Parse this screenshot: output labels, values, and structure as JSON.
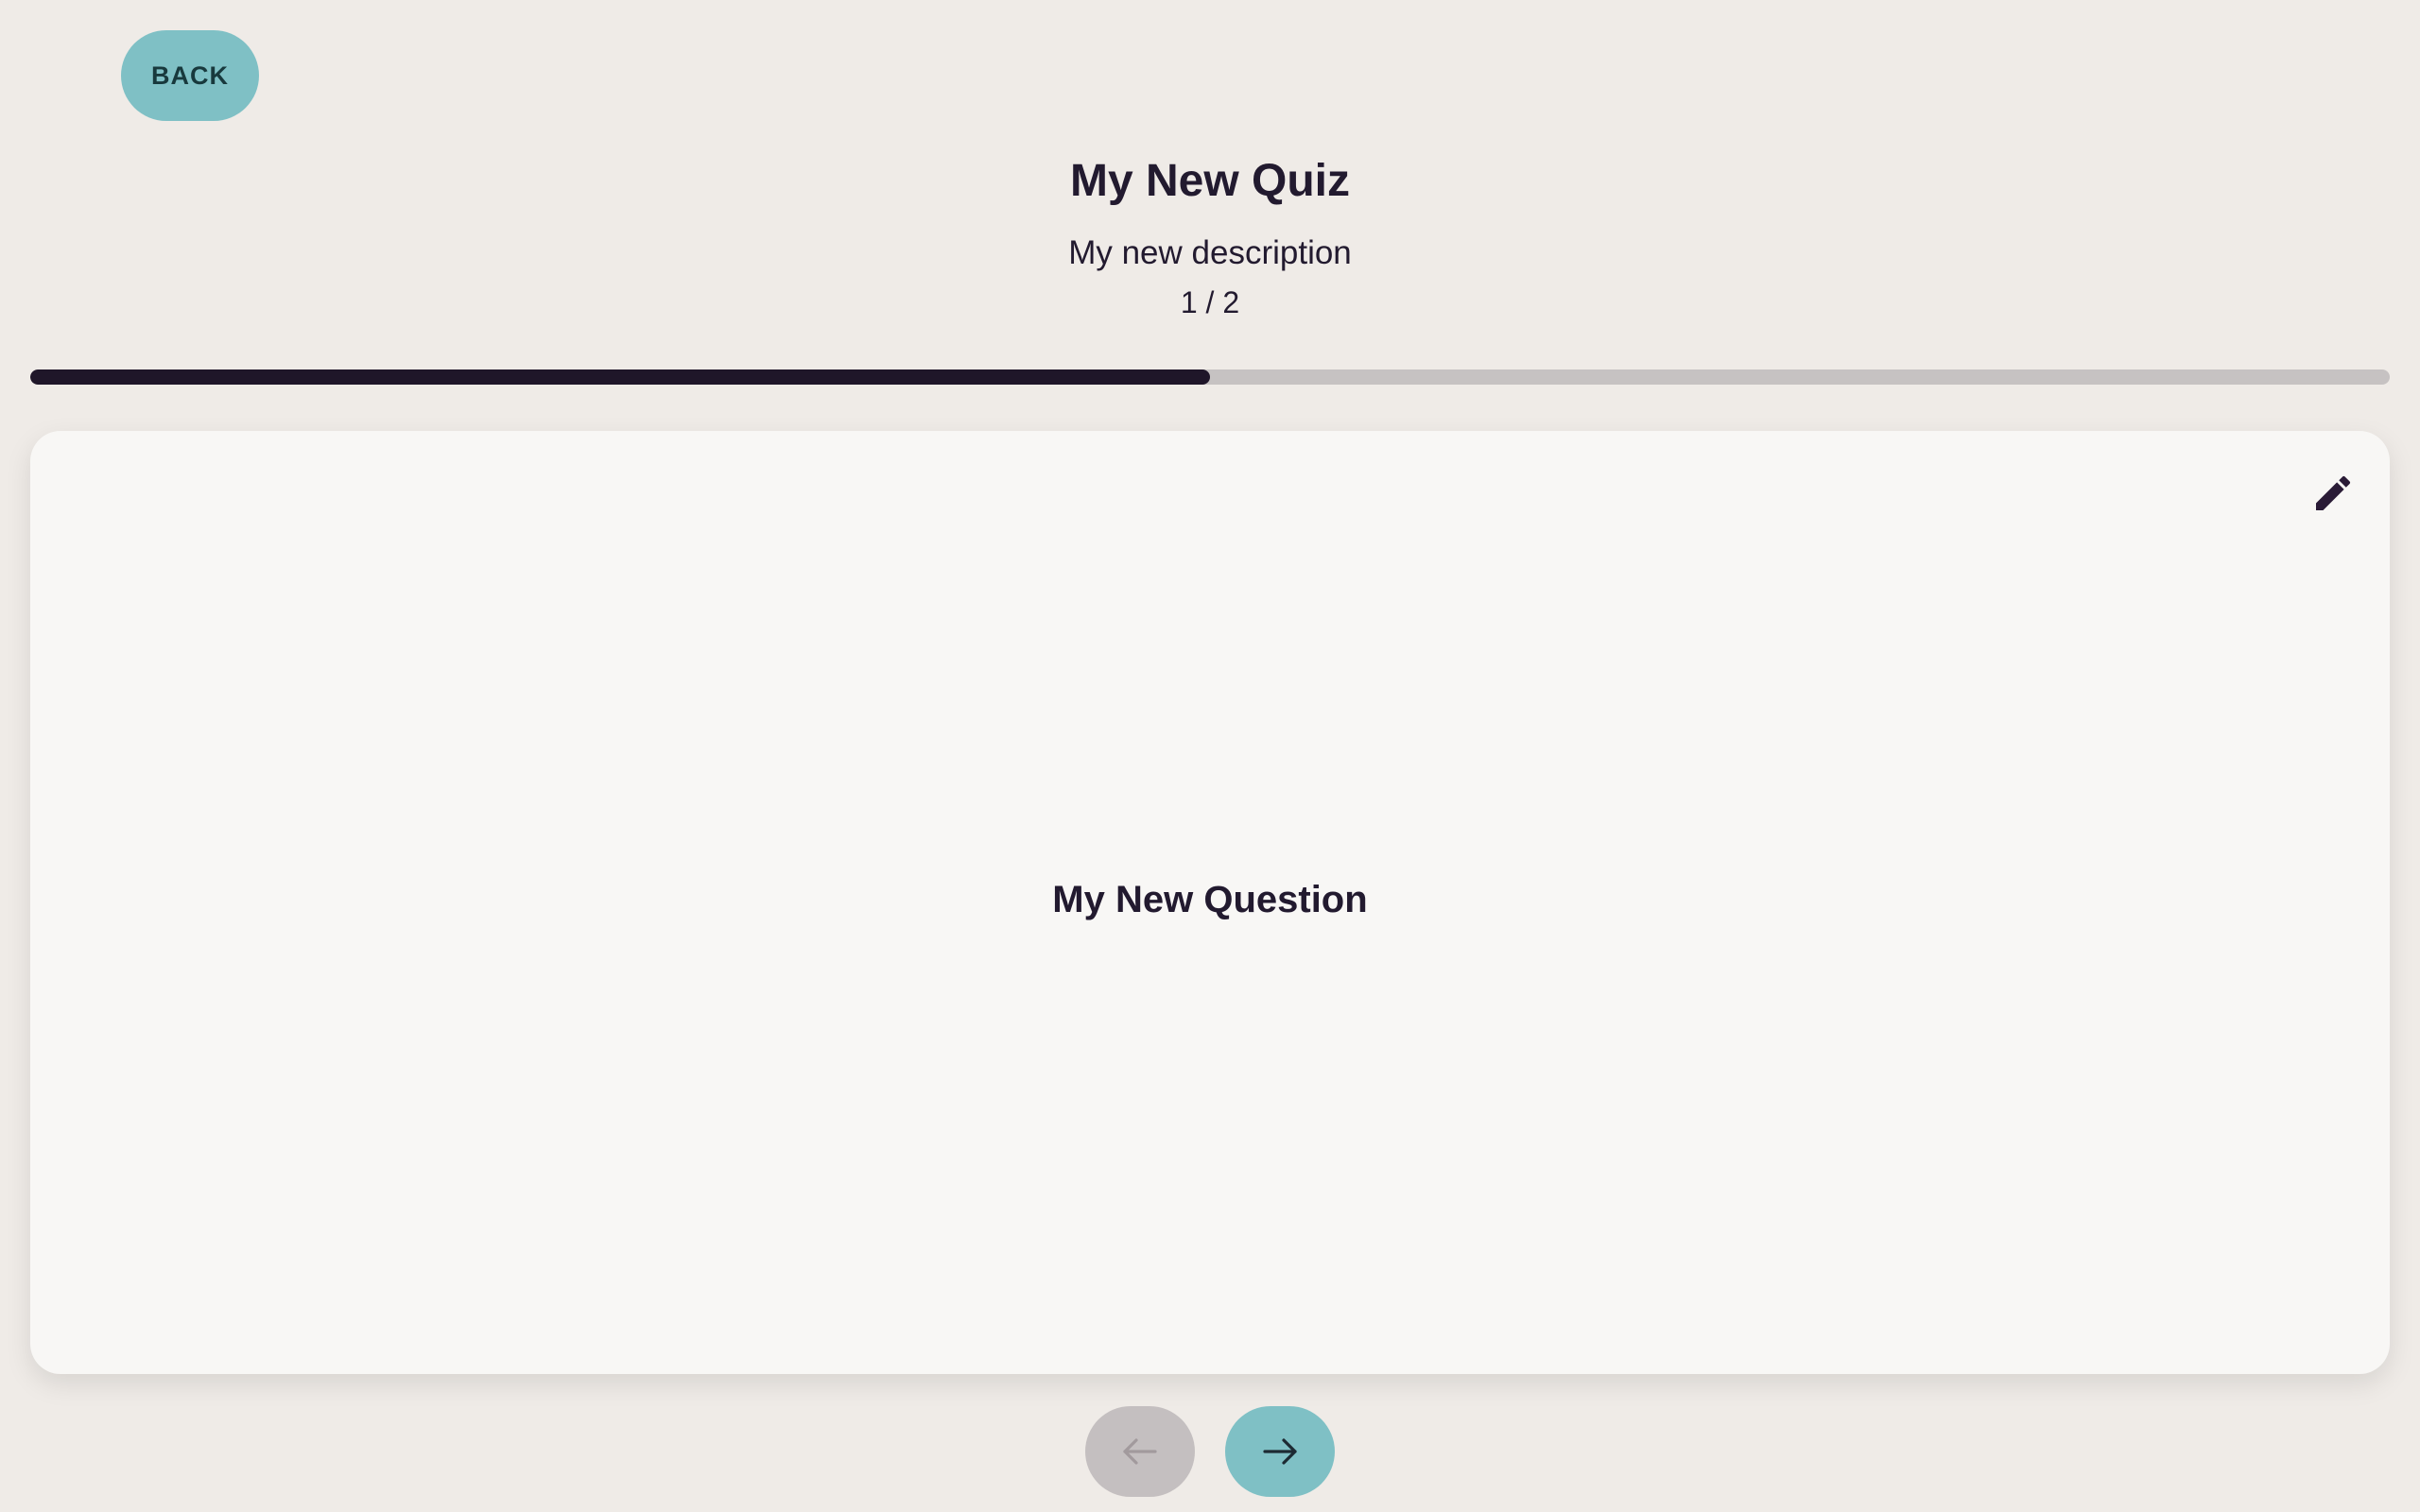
{
  "header": {
    "back_label": "BACK"
  },
  "quiz": {
    "title": "My New Quiz",
    "description": "My new description",
    "counter": "1 / 2",
    "progress_fraction": 0.5
  },
  "card": {
    "question": "My New Question",
    "edit_icon": "pencil-icon"
  },
  "navigation": {
    "prev_icon": "arrow-left-icon",
    "prev_enabled": false,
    "next_icon": "arrow-right-icon",
    "next_enabled": true
  },
  "colors": {
    "background": "#efebe7",
    "accent": "#7fc0c5",
    "text": "#221a2f",
    "progress_fill": "#1f1629",
    "progress_track": "#c6c2c2",
    "disabled": "#c4bfc0",
    "card": "#f8f7f5"
  }
}
